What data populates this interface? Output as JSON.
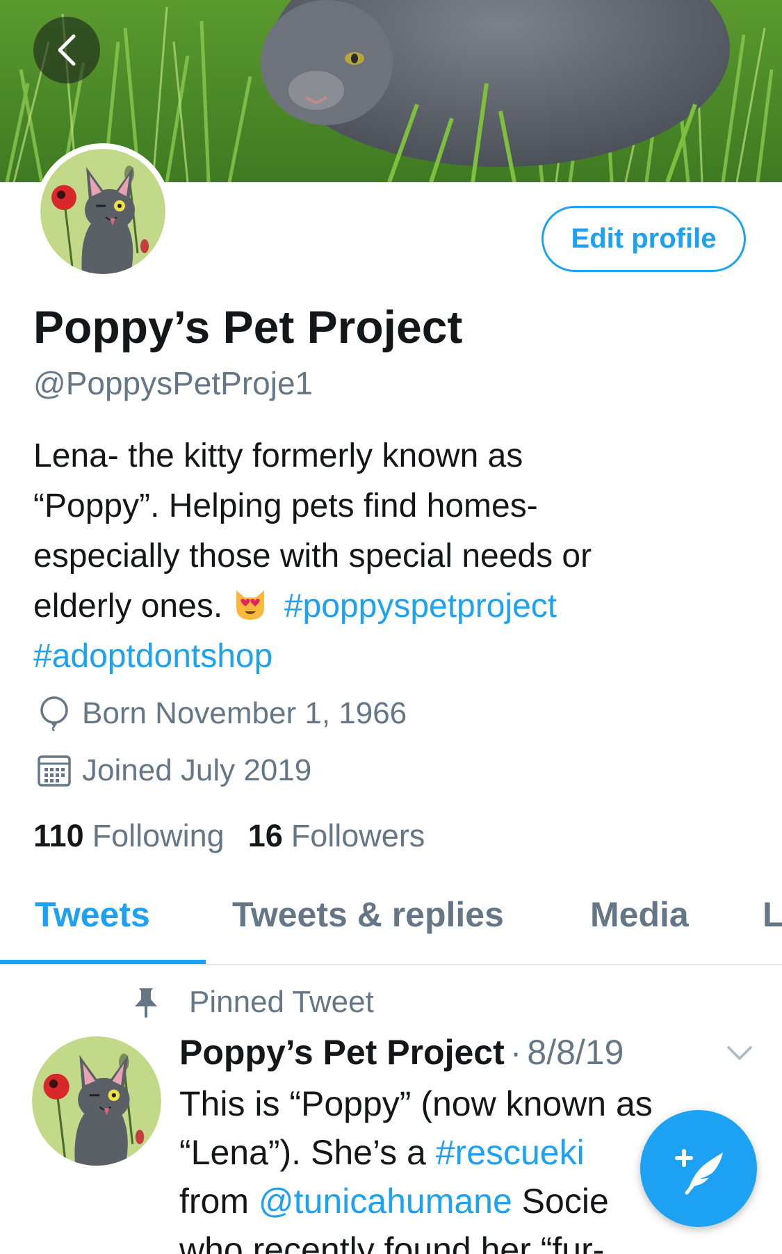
{
  "header": {
    "back_icon": "chevron-left-icon"
  },
  "profile": {
    "edit_label": "Edit profile",
    "name": "Poppy’s Pet Project",
    "handle": "@PoppysPetProje1",
    "bio": {
      "line1": "Lena- the kitty formerly known as",
      "line2": "“Poppy”. Helping pets find homes-",
      "line3": "especially those with special needs or",
      "line4_text": "elderly ones.",
      "emoji": "heart-eyes-cat-emoji",
      "hashtag1": "#poppyspetproject",
      "hashtag2": "#adoptdontshop"
    },
    "born": "Born November 1, 1966",
    "joined": "Joined July 2019",
    "following_count": "110",
    "following_label": "Following",
    "followers_count": "16",
    "followers_label": "Followers"
  },
  "tabs": [
    {
      "label": "Tweets",
      "active": true
    },
    {
      "label": "Tweets & replies",
      "active": false
    },
    {
      "label": "Media",
      "active": false
    },
    {
      "label": "L",
      "active": false
    }
  ],
  "pinned_tweet": {
    "label": "Pinned Tweet",
    "author": "Poppy’s Pet Project",
    "separator": "·",
    "date": "8/8/19",
    "line1": "This is “Poppy” (now known as",
    "line2_text": "“Lena”). She’s a ",
    "line2_link": "#rescueki",
    "line3_text": "from ",
    "line3_link": "@tunicahumane",
    "line3_tail": " Socie",
    "line4": "who recently found her “fur-"
  },
  "colors": {
    "accent": "#1da1f2",
    "secondary_text": "#657786",
    "primary_text": "#14171a",
    "divider": "#e1e8ed"
  },
  "compose_icon": "compose-feather-icon"
}
